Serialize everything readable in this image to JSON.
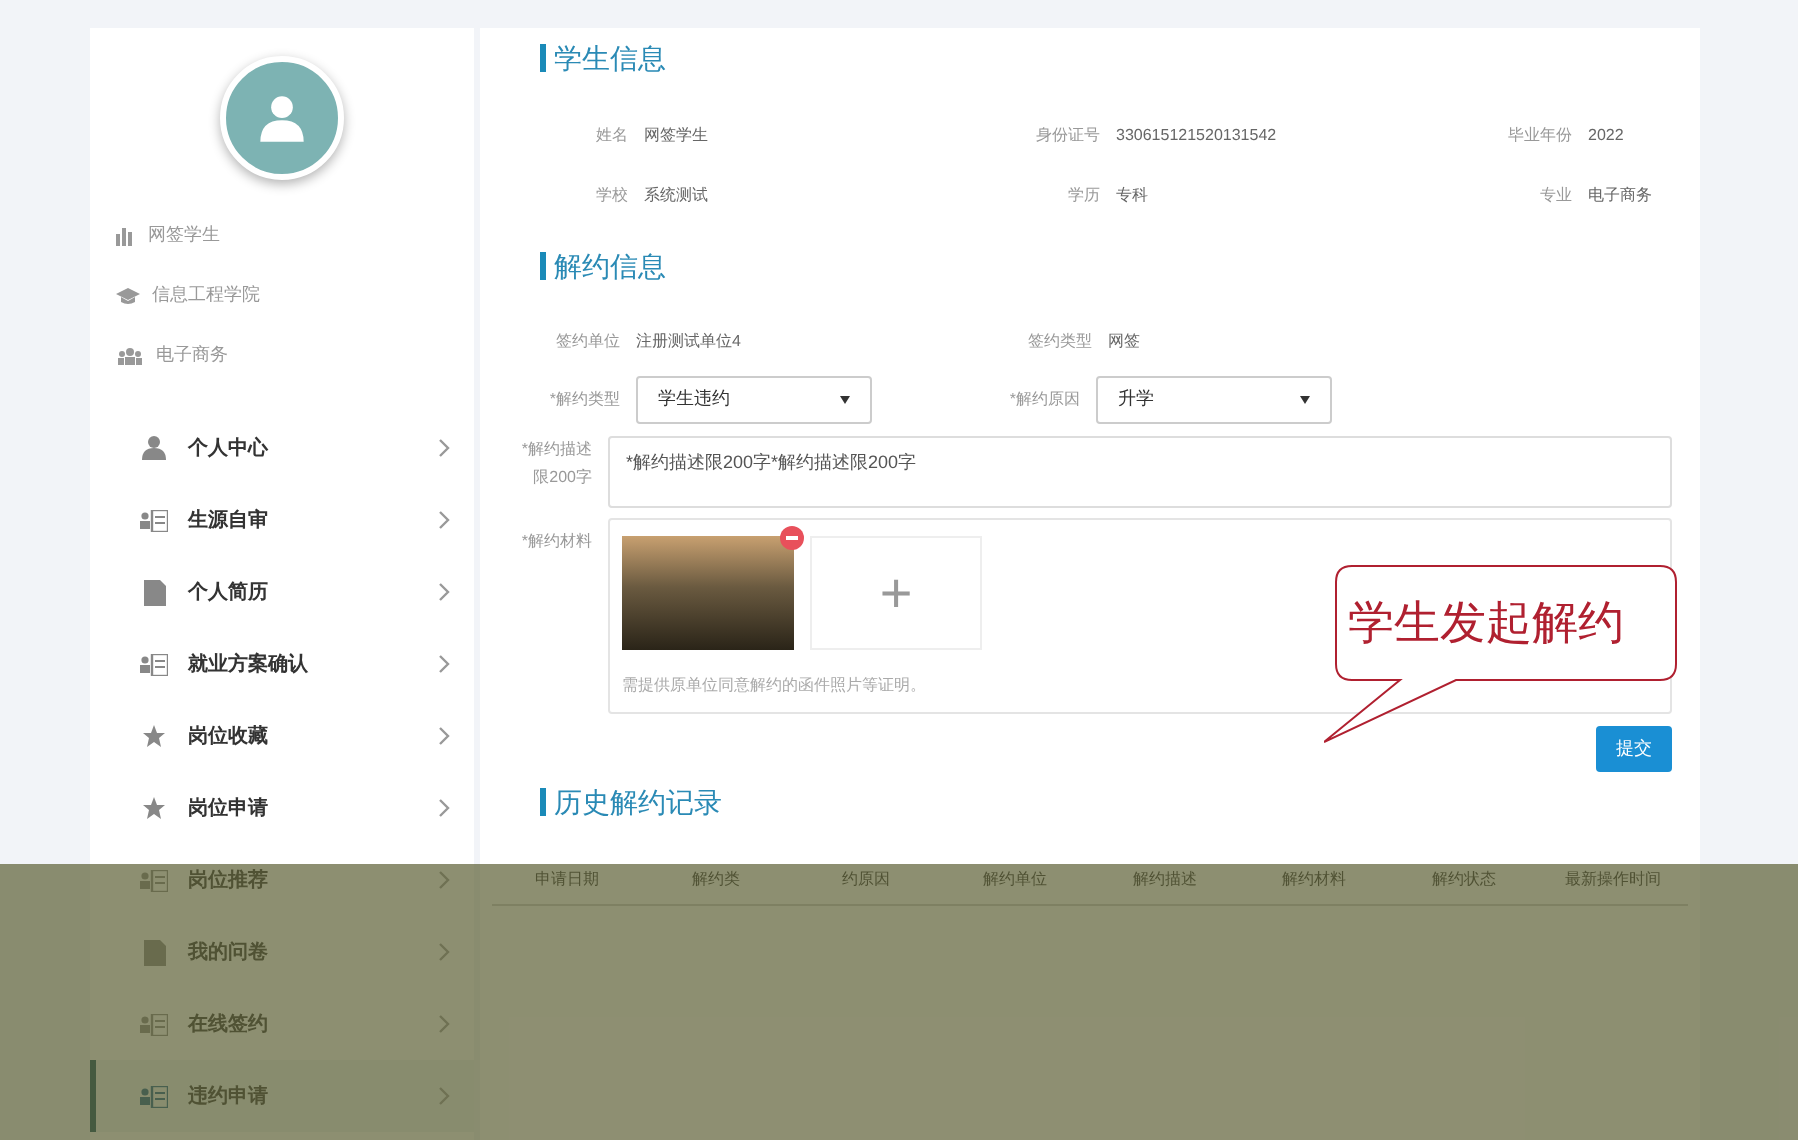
{
  "profile": {
    "items": [
      {
        "kind": "bars",
        "text": "网签学生"
      },
      {
        "kind": "cap",
        "text": "信息工程学院"
      },
      {
        "kind": "group",
        "text": "电子商务"
      }
    ]
  },
  "sidebar": {
    "items": [
      {
        "kind": "person",
        "label": "个人中心",
        "selected": false
      },
      {
        "kind": "card",
        "label": "生源自审",
        "selected": false
      },
      {
        "kind": "doc",
        "label": "个人简历",
        "selected": false
      },
      {
        "kind": "card",
        "label": "就业方案确认",
        "selected": false
      },
      {
        "kind": "star",
        "label": "岗位收藏",
        "selected": false
      },
      {
        "kind": "star",
        "label": "岗位申请",
        "selected": false
      },
      {
        "kind": "card",
        "label": "岗位推荐",
        "selected": false
      },
      {
        "kind": "doc",
        "label": "我的问卷",
        "selected": false
      },
      {
        "kind": "card",
        "label": "在线签约",
        "selected": false
      },
      {
        "kind": "card",
        "label": "违约申请",
        "selected": true
      }
    ]
  },
  "student_info": {
    "title": "学生信息",
    "fields": [
      {
        "label": "姓名",
        "value": "网签学生"
      },
      {
        "label": "身份证号",
        "value": "330615121520131542"
      },
      {
        "label": "毕业年份",
        "value": "2022"
      },
      {
        "label": "学校",
        "value": "系统测试"
      },
      {
        "label": "学历",
        "value": "专科"
      },
      {
        "label": "专业",
        "value": "电子商务"
      }
    ]
  },
  "cancel_info": {
    "title": "解约信息",
    "fields": [
      {
        "label": "签约单位",
        "value": "注册测试单位4"
      },
      {
        "label": "签约类型",
        "value": "网签"
      }
    ],
    "selects": [
      {
        "label": "*解约类型",
        "value": "学生违约"
      },
      {
        "label": "*解约原因",
        "value": "升学"
      }
    ],
    "description": {
      "label": "*解约描述限200字",
      "value": "*解约描述限200字*解约描述限200字"
    },
    "materials": {
      "label": "*解约材料",
      "add": "+",
      "hint": "需提供原单位同意解约的函件照片等证明。"
    },
    "submit": "提交"
  },
  "callout": {
    "text": "学生发起解约"
  },
  "history": {
    "title": "历史解约记录",
    "columns": [
      "申请日期",
      "解约类",
      "约原因",
      "解约单位",
      "解约描述",
      "解约材料",
      "解约状态",
      "最新操作时间"
    ]
  }
}
